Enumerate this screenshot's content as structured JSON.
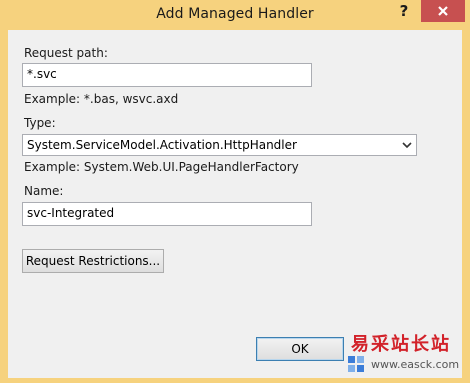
{
  "window": {
    "title": "Add Managed Handler",
    "help_glyph": "?",
    "close_glyph": "X"
  },
  "fields": {
    "request_path": {
      "label": "Request path:",
      "value": "*.svc",
      "example": "Example: *.bas, wsvc.axd"
    },
    "type": {
      "label": "Type:",
      "value": "System.ServiceModel.Activation.HttpHandler",
      "example": "Example: System.Web.UI.PageHandlerFactory"
    },
    "name": {
      "label": "Name:",
      "value": "svc-Integrated"
    }
  },
  "buttons": {
    "request_restrictions": "Request Restrictions...",
    "ok": "OK"
  },
  "watermark": {
    "brand": "易采站长站",
    "url": "www.easck.com"
  },
  "colors": {
    "frame": "#f6d27e",
    "close": "#c75050",
    "client": "#f0f0f0"
  }
}
